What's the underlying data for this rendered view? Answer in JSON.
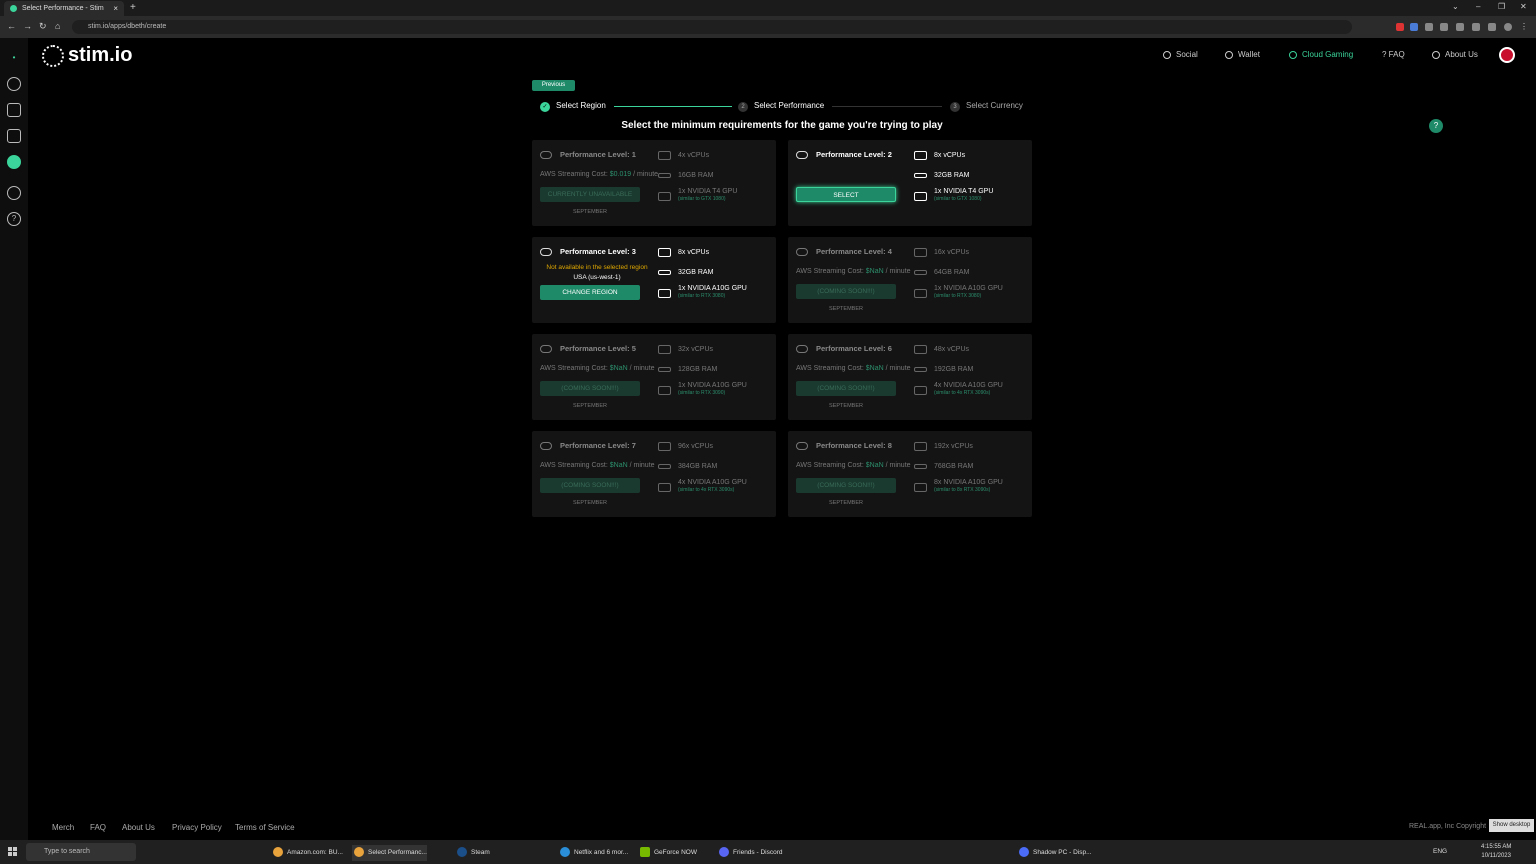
{
  "browser": {
    "tab_title": "Select Performance - Stim",
    "url": "stim.io/apps/dbeth/create",
    "new_tab": "+"
  },
  "header": {
    "logo": "stim.io",
    "nav": [
      {
        "label": "Social"
      },
      {
        "label": "Wallet"
      },
      {
        "label": "Cloud Gaming"
      },
      {
        "label": "? FAQ"
      },
      {
        "label": "About Us"
      }
    ]
  },
  "stepper": {
    "previous_label": "Previous",
    "steps": [
      {
        "num": "✓",
        "label": "Select Region"
      },
      {
        "num": "2",
        "label": "Select Performance"
      },
      {
        "num": "3",
        "label": "Select Currency"
      }
    ]
  },
  "heading": "Select the minimum requirements for the game you're trying to play",
  "help_label": "?",
  "cards": [
    {
      "title": "Performance Level: 1",
      "cost_label": "AWS Streaming Cost:",
      "cost_value": "$0.019",
      "cost_unit": "/ minute",
      "button": "CURRENTLY UNAVAILABLE",
      "month": "SEPTEMBER",
      "cpu": "4x vCPUs",
      "ram": "16GB RAM",
      "gpu": "1x NVIDIA T4 GPU",
      "gpu_sub": "(similar to GTX 1080)"
    },
    {
      "title": "Performance Level: 2",
      "button": "SELECT",
      "cpu": "8x vCPUs",
      "ram": "32GB RAM",
      "gpu": "1x NVIDIA T4 GPU",
      "gpu_sub": "(similar to GTX 1080)"
    },
    {
      "title": "Performance Level: 3",
      "warn_line1": "Not available in the selected region",
      "warn_line2": "USA (us-west-1)",
      "button": "CHANGE REGION",
      "cpu": "8x vCPUs",
      "ram": "32GB RAM",
      "gpu": "1x NVIDIA A10G GPU",
      "gpu_sub": "(similar to RTX 3080)"
    },
    {
      "title": "Performance Level: 4",
      "cost_label": "AWS Streaming Cost:",
      "cost_value": "$NaN",
      "cost_unit": "/ minute",
      "button": "(COMING SOON!!!)",
      "month": "SEPTEMBER",
      "cpu": "16x vCPUs",
      "ram": "64GB RAM",
      "gpu": "1x NVIDIA A10G GPU",
      "gpu_sub": "(similar to RTX 3080)"
    },
    {
      "title": "Performance Level: 5",
      "cost_label": "AWS Streaming Cost:",
      "cost_value": "$NaN",
      "cost_unit": "/ minute",
      "button": "(COMING SOON!!!)",
      "month": "SEPTEMBER",
      "cpu": "32x vCPUs",
      "ram": "128GB RAM",
      "gpu": "1x NVIDIA A10G GPU",
      "gpu_sub": "(similar to RTX 3090)"
    },
    {
      "title": "Performance Level: 6",
      "cost_label": "AWS Streaming Cost:",
      "cost_value": "$NaN",
      "cost_unit": "/ minute",
      "button": "(COMING SOON!!!)",
      "month": "SEPTEMBER",
      "cpu": "48x vCPUs",
      "ram": "192GB RAM",
      "gpu": "4x NVIDIA A10G GPU",
      "gpu_sub": "(similar to 4x RTX 3090s)"
    },
    {
      "title": "Performance Level: 7",
      "cost_label": "AWS Streaming Cost:",
      "cost_value": "$NaN",
      "cost_unit": "/ minute",
      "button": "(COMING SOON!!!)",
      "month": "SEPTEMBER",
      "cpu": "96x vCPUs",
      "ram": "384GB RAM",
      "gpu": "4x NVIDIA A10G GPU",
      "gpu_sub": "(similar to 4x RTX 3090s)"
    },
    {
      "title": "Performance Level: 8",
      "cost_label": "AWS Streaming Cost:",
      "cost_value": "$NaN",
      "cost_unit": "/ minute",
      "button": "(COMING SOON!!!)",
      "month": "SEPTEMBER",
      "cpu": "192x vCPUs",
      "ram": "768GB RAM",
      "gpu": "8x NVIDIA A10G GPU",
      "gpu_sub": "(similar to 8x RTX 3090s)"
    }
  ],
  "footer": {
    "links": [
      "Merch",
      "FAQ",
      "About Us",
      "Privacy Policy",
      "Terms of Service"
    ],
    "copyright": "REAL.app, Inc Copyright",
    "show_desktop": "Show desktop"
  },
  "taskbar": {
    "search_placeholder": "Type to search",
    "items": [
      "Amazon.com: BU...",
      "Select Performanc...",
      "Steam",
      "Netflix and 6 mor...",
      "GeForce NOW",
      "Friends - Discord",
      "Shadow PC - Disp..."
    ],
    "lang": "ENG",
    "time": "4:15:55 AM",
    "date": "10/11/2023"
  },
  "colors": {
    "accent": "#3bd49a",
    "button": "#1f8a68",
    "warn": "#e0a800"
  }
}
